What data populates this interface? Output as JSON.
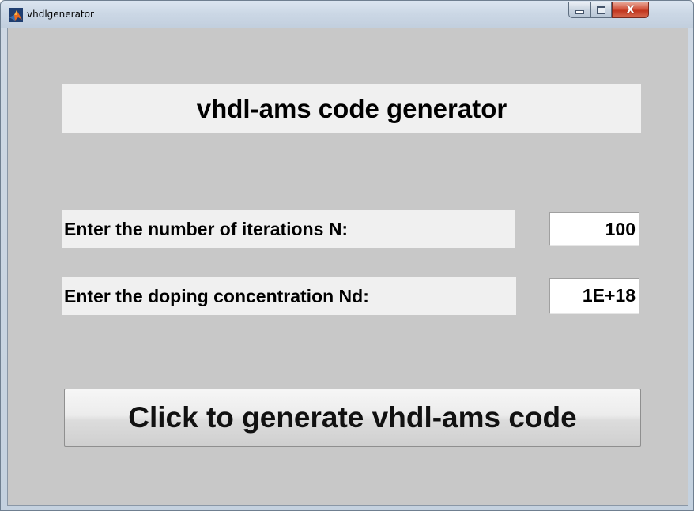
{
  "window": {
    "title": "vhdlgenerator",
    "app_icon": "matlab-icon",
    "controls": {
      "minimize_icon": "minimize-icon",
      "maximize_icon": "maximize-icon",
      "close_icon": "close-icon",
      "close_glyph": "X"
    }
  },
  "form": {
    "header": "vhdl-ams code generator",
    "iterations_label": "Enter the number of iterations N:",
    "iterations_value": "100",
    "doping_label": "Enter the doping concentration Nd:",
    "doping_value": "1E+18",
    "generate_button": "Click to generate vhdl-ams code"
  },
  "colors": {
    "panel_background": "#c8c8c8",
    "text_background": "#f0f0f0",
    "close_button": "#c1351e"
  }
}
